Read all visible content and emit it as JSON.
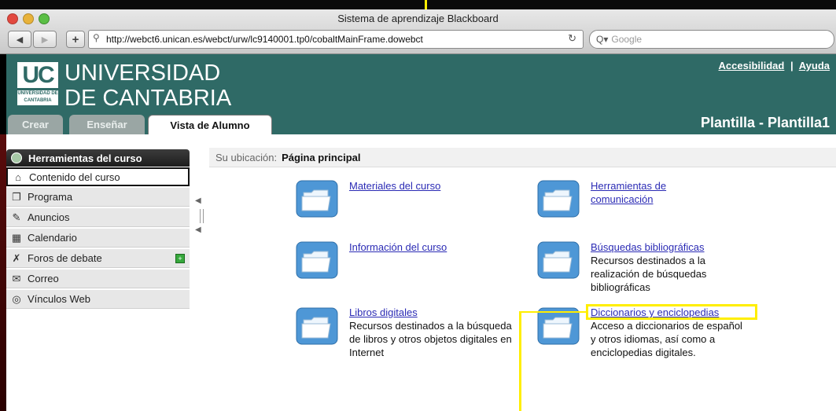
{
  "window": {
    "title": "Sistema de aprendizaje Blackboard",
    "url": "http://webct6.unican.es/webct/urw/lc9140001.tp0/cobaltMainFrame.dowebct",
    "search_placeholder": "Google"
  },
  "header": {
    "logo_text": "UC",
    "logo_subtext": "UNIVERSIDAD DE CANTABRIA",
    "university_line1": "UNIVERSIDAD",
    "university_line2": "DE CANTABRIA",
    "links": [
      "Accesibilidad",
      "Ayuda"
    ],
    "link_separator": "|",
    "tabs": [
      {
        "label": "Crear",
        "active": false
      },
      {
        "label": "Enseñar",
        "active": false
      },
      {
        "label": "Vista de Alumno",
        "active": true
      }
    ],
    "course_title": "Plantilla - Plantilla1"
  },
  "sidebar": {
    "title": "Herramientas del curso",
    "items": [
      {
        "label": "Contenido del curso",
        "icon": "home-icon",
        "selected": true
      },
      {
        "label": "Programa",
        "icon": "syllabus-icon"
      },
      {
        "label": "Anuncios",
        "icon": "announcement-icon"
      },
      {
        "label": "Calendario",
        "icon": "calendar-icon"
      },
      {
        "label": "Foros de debate",
        "icon": "pushpin-icon",
        "badge": "+"
      },
      {
        "label": "Correo",
        "icon": "mail-icon"
      },
      {
        "label": "Vínculos Web",
        "icon": "globe-icon"
      }
    ]
  },
  "breadcrumb": {
    "label": "Su ubicación:",
    "value": "Página principal"
  },
  "folders": [
    {
      "title": "Materiales del curso",
      "description": ""
    },
    {
      "title": "Herramientas de comunicación",
      "description": ""
    },
    {
      "title": "Información del curso",
      "description": ""
    },
    {
      "title": "Búsquedas bibliográficas",
      "description": "Recursos destinados a la realización de búsquedas bibliográficas"
    },
    {
      "title": "Libros digitales",
      "description": "Recursos destinados a la búsqueda de libros y otros objetos digitales en Internet"
    },
    {
      "title": "Diccionarios y enciclopedias",
      "description": "Acceso a diccionarios de español y otros idiomas, así como a enciclopedias digitales."
    }
  ],
  "colors": {
    "header_teal": "#2f6a66",
    "link_blue": "#2b2bb5",
    "annotation_yellow": "#ffee00",
    "folder_blue": "#4e97d6"
  }
}
